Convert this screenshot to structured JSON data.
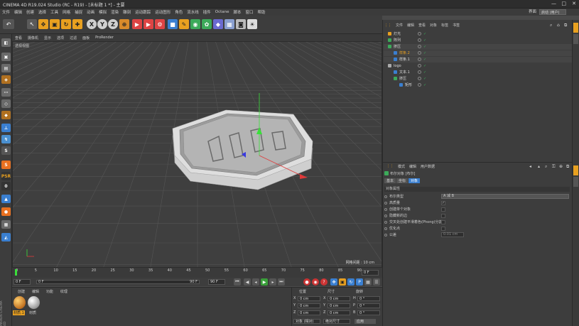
{
  "window": {
    "title": "CINEMA 4D R19.024 Studio (RC - R19) - [未标题 1 *] - 主要",
    "controls": [
      "—",
      "□",
      "✕"
    ]
  },
  "menubar": [
    "文件",
    "编辑",
    "创建",
    "选择",
    "工具",
    "网格",
    "捕捉",
    "动画",
    "模拟",
    "渲染",
    "雕刻",
    "运动跟踪",
    "运动图形",
    "角色",
    "流水线",
    "插件",
    "Octane",
    "脚本",
    "窗口",
    "帮助"
  ],
  "layout": {
    "label": "界面",
    "value": "启动 (用户)"
  },
  "toolbar": {
    "axis_x": "X",
    "axis_y": "Y",
    "axis_z": "Z"
  },
  "viewport": {
    "menu": [
      "查看",
      "摄像机",
      "显示",
      "选项",
      "过滤",
      "面板",
      "ProRender"
    ],
    "label": "透视视图",
    "grid_info": "网格间距 : 10 cm"
  },
  "timeline": {
    "ticks": [
      "0",
      "5",
      "10",
      "15",
      "20",
      "25",
      "30",
      "35",
      "40",
      "45",
      "50",
      "55",
      "60",
      "65",
      "70",
      "75",
      "80",
      "85",
      "90"
    ],
    "end_frame": "0 F",
    "current": "0 F",
    "start_field": "0 F",
    "min_field": "0 F",
    "max_field": "90 F",
    "end_field": "90 F"
  },
  "materials": {
    "menu": [
      "创建",
      "编辑",
      "功能",
      "纹理"
    ],
    "items": [
      {
        "name": "材质.1"
      },
      {
        "name": "材质"
      }
    ],
    "brand": "MAXON CINEMA 4D"
  },
  "coords": {
    "headers": [
      "位置",
      "尺寸",
      "旋转"
    ],
    "rows": [
      {
        "axis": "X",
        "pos": "0 cm",
        "size_axis": "X",
        "size": "0 cm",
        "rot_axis": "H",
        "rot": "0 °"
      },
      {
        "axis": "Y",
        "pos": "0 cm",
        "size_axis": "Y",
        "size": "0 cm",
        "rot_axis": "P",
        "rot": "0 °"
      },
      {
        "axis": "Z",
        "pos": "0 cm",
        "size_axis": "Z",
        "size": "0 cm",
        "rot_axis": "B",
        "rot": "0 °"
      }
    ],
    "mode": "对象 (相对)",
    "size_mode": "绝对尺寸",
    "apply": "应用"
  },
  "objects": {
    "menu": [
      "文件",
      "编辑",
      "查看",
      "对象",
      "标签",
      "书签"
    ],
    "items": [
      {
        "name": "灯光",
        "indent": 0
      },
      {
        "name": "阵列",
        "indent": 0
      },
      {
        "name": "挤压",
        "indent": 0
      },
      {
        "name": "样条.2",
        "indent": 1
      },
      {
        "name": "样条.1",
        "indent": 1
      },
      {
        "name": "logo",
        "indent": 0
      },
      {
        "name": "文本.1",
        "indent": 1
      },
      {
        "name": "挤压",
        "indent": 1
      },
      {
        "name": "矩形",
        "indent": 2
      }
    ]
  },
  "attributes": {
    "menu": [
      "模式",
      "编辑",
      "用户数据"
    ],
    "title": "布尔对象 [布尔]",
    "tabs": [
      "基本",
      "坐标",
      "对象"
    ],
    "section": "对象属性",
    "fields": [
      {
        "label": "布尔类型",
        "value": "A 减 B"
      },
      {
        "label": "高质量",
        "value": "✓"
      },
      {
        "label": "创建单个对象",
        "value": ""
      },
      {
        "label": "隐藏新的边",
        "value": ""
      },
      {
        "label": "交叉处创建平滑着色(Phong)分割",
        "value": ""
      },
      {
        "label": "优化点",
        "value": ""
      },
      {
        "label": "公差",
        "value": "0.01 cm"
      }
    ]
  }
}
